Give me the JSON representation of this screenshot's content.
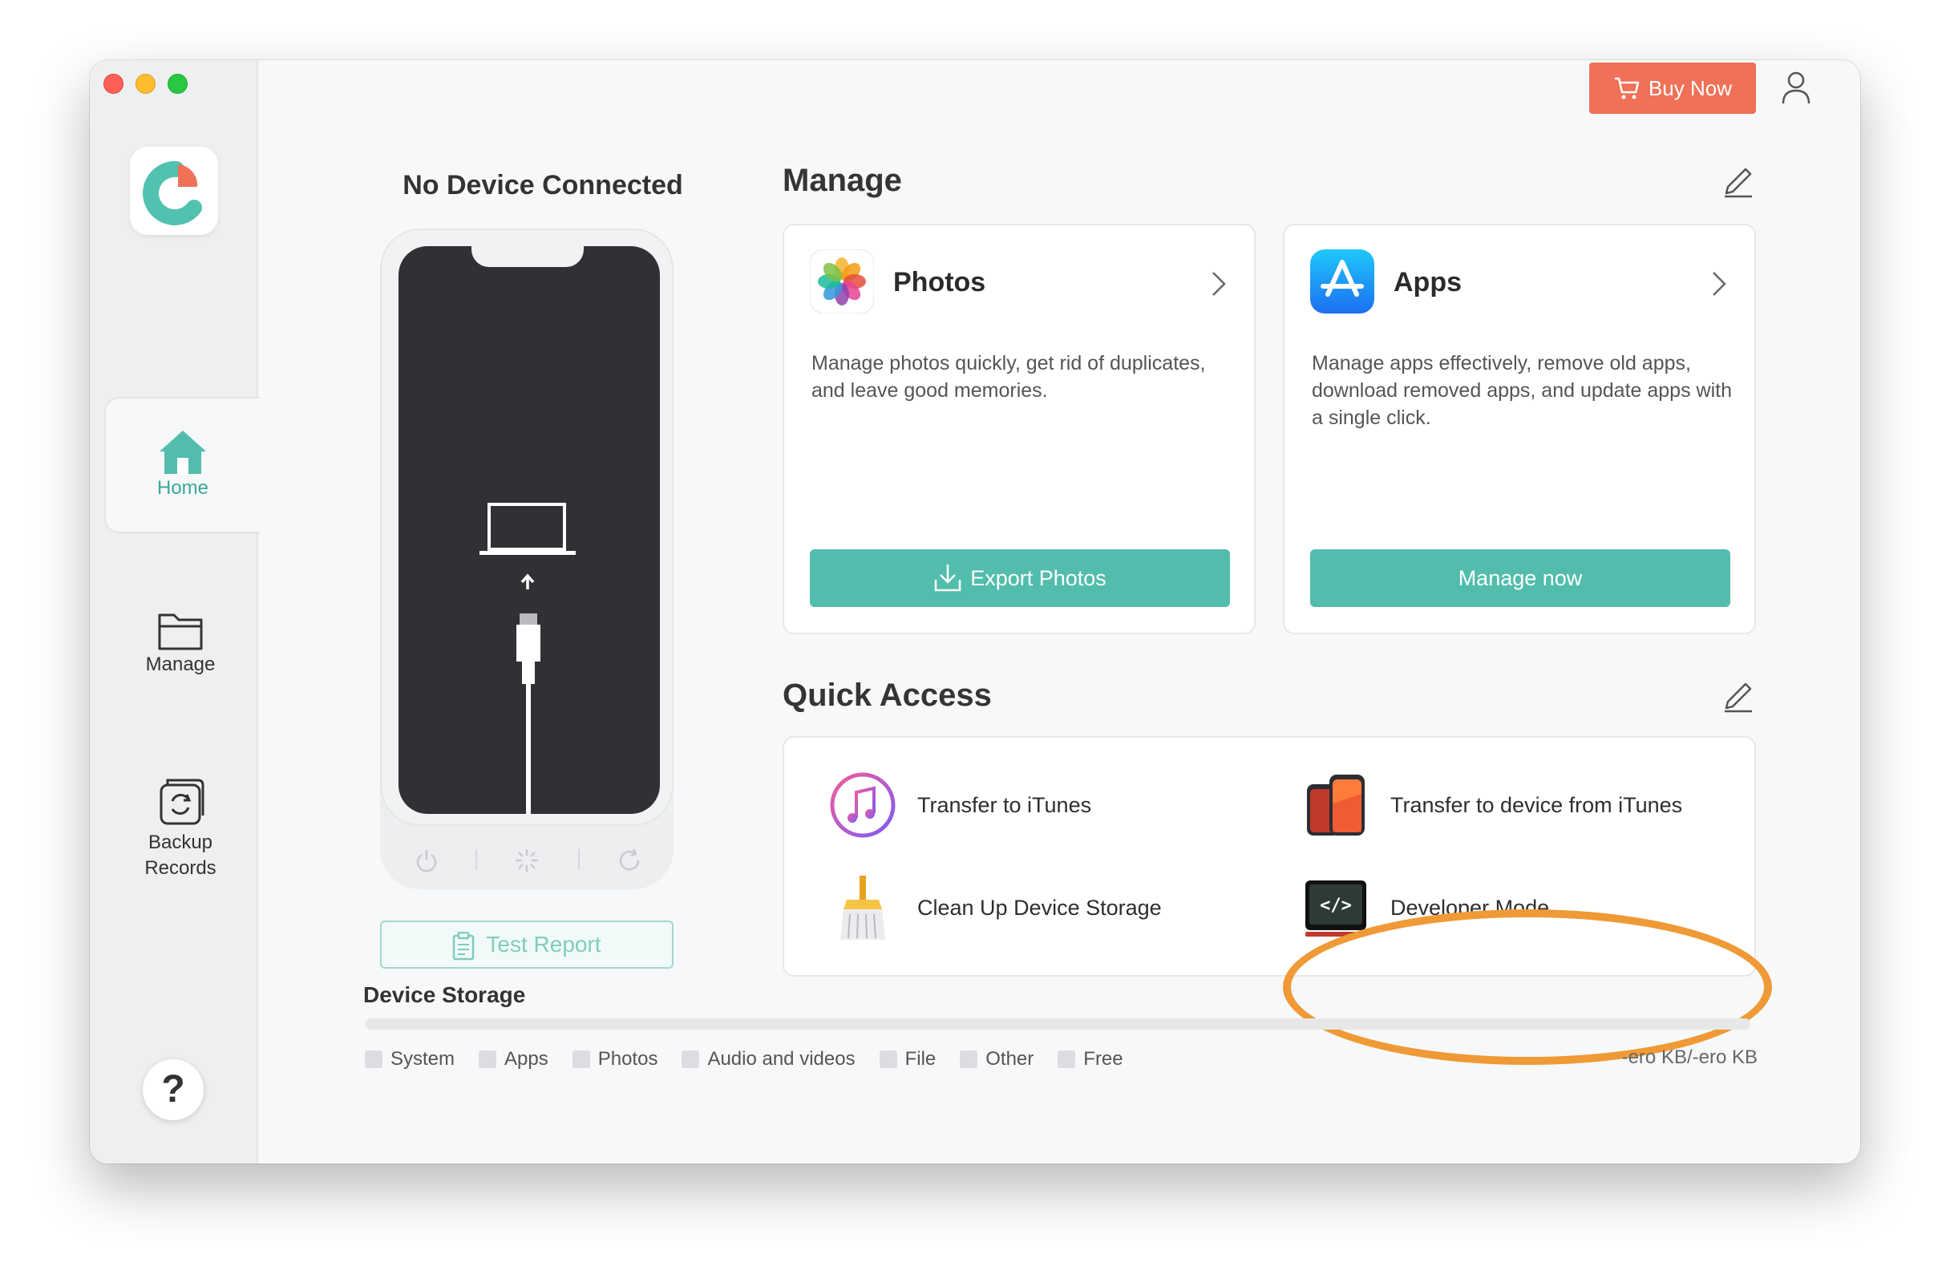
{
  "header": {
    "buy_label": "Buy Now"
  },
  "sidebar": {
    "items": [
      {
        "label": "Home",
        "icon": "home-icon",
        "active": true
      },
      {
        "label": "Manage",
        "icon": "folder-icon",
        "active": false
      },
      {
        "label": "Backup Records",
        "icon": "backup-icon",
        "active": false
      }
    ],
    "help_label": "?"
  },
  "device": {
    "status": "No Device Connected",
    "test_report_label": "Test Report"
  },
  "manage": {
    "title": "Manage",
    "cards": [
      {
        "title": "Photos",
        "description": "Manage photos quickly, get rid of duplicates, and leave good memories.",
        "button": "Export Photos"
      },
      {
        "title": "Apps",
        "description": "Manage apps effectively, remove old apps, download removed apps, and update apps with a single click.",
        "button": "Manage now"
      }
    ]
  },
  "quick_access": {
    "title": "Quick Access",
    "items": [
      {
        "label": "Transfer to iTunes",
        "icon": "itunes-icon"
      },
      {
        "label": "Transfer to device from iTunes",
        "icon": "phones-icon"
      },
      {
        "label": "Clean Up Device Storage",
        "icon": "broom-icon"
      },
      {
        "label": "Developer Mode",
        "icon": "developer-icon"
      }
    ]
  },
  "storage": {
    "title": "Device Storage",
    "legend": [
      "System",
      "Apps",
      "Photos",
      "Audio and videos",
      "File",
      "Other",
      "Free"
    ],
    "value": "-ero KB/-ero KB"
  },
  "colors": {
    "accent": "#52bdac",
    "buy": "#ef7157",
    "highlight": "#ef9a36"
  }
}
